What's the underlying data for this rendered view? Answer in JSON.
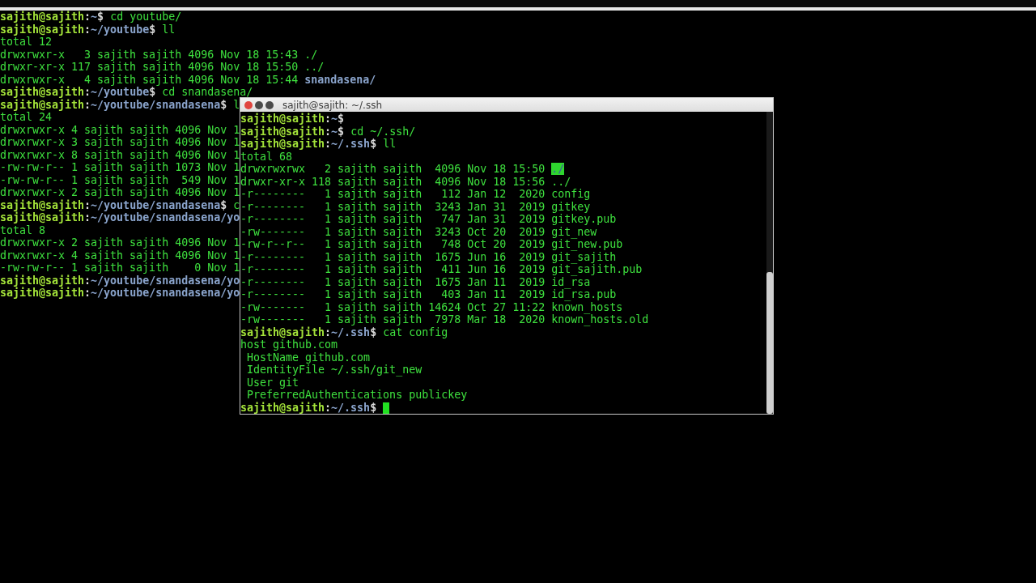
{
  "background_terminal": {
    "lines": [
      {
        "segments": [
          {
            "text": "sajith@sajith",
            "kind": "user"
          },
          {
            "text": ":",
            "kind": "sep"
          },
          {
            "text": "~",
            "kind": "path"
          },
          {
            "text": "$ ",
            "kind": "sep"
          },
          {
            "text": "cd youtube/",
            "kind": "cmd"
          }
        ]
      },
      {
        "segments": [
          {
            "text": "sajith@sajith",
            "kind": "user"
          },
          {
            "text": ":",
            "kind": "sep"
          },
          {
            "text": "~/youtube",
            "kind": "path"
          },
          {
            "text": "$ ",
            "kind": "sep"
          },
          {
            "text": "ll",
            "kind": "cmd"
          }
        ]
      },
      {
        "segments": [
          {
            "text": "total 12",
            "kind": "out"
          }
        ]
      },
      {
        "segments": [
          {
            "text": "drwxrwxr-x   3 sajith sajith 4096 Nov 18 15:43 ",
            "kind": "out"
          },
          {
            "text": "./",
            "kind": "out"
          }
        ]
      },
      {
        "segments": [
          {
            "text": "drwxr-xr-x 117 sajith sajith 4096 Nov 18 15:50 ",
            "kind": "out"
          },
          {
            "text": "../",
            "kind": "out"
          }
        ]
      },
      {
        "segments": [
          {
            "text": "drwxrwxr-x   4 sajith sajith 4096 Nov 18 15:44 ",
            "kind": "out"
          },
          {
            "text": "snandasena/",
            "kind": "dir"
          }
        ]
      },
      {
        "segments": [
          {
            "text": "sajith@sajith",
            "kind": "user"
          },
          {
            "text": ":",
            "kind": "sep"
          },
          {
            "text": "~/youtube",
            "kind": "path"
          },
          {
            "text": "$ ",
            "kind": "sep"
          },
          {
            "text": "cd snandasena/",
            "kind": "cmd"
          }
        ]
      },
      {
        "segments": [
          {
            "text": "sajith@sajith",
            "kind": "user"
          },
          {
            "text": ":",
            "kind": "sep"
          },
          {
            "text": "~/youtube/snandasena",
            "kind": "path"
          },
          {
            "text": "$ ",
            "kind": "sep"
          },
          {
            "text": "l",
            "kind": "cmd"
          }
        ]
      },
      {
        "segments": [
          {
            "text": "total 24",
            "kind": "out"
          }
        ]
      },
      {
        "segments": [
          {
            "text": "drwxrwxr-x 4 sajith sajith 4096 Nov 1",
            "kind": "out"
          }
        ]
      },
      {
        "segments": [
          {
            "text": "drwxrwxr-x 3 sajith sajith 4096 Nov 1",
            "kind": "out"
          }
        ]
      },
      {
        "segments": [
          {
            "text": "drwxrwxr-x 8 sajith sajith 4096 Nov 1",
            "kind": "out"
          }
        ]
      },
      {
        "segments": [
          {
            "text": "-rw-rw-r-- 1 sajith sajith 1073 Nov 1",
            "kind": "out"
          }
        ]
      },
      {
        "segments": [
          {
            "text": "-rw-rw-r-- 1 sajith sajith  549 Nov 1",
            "kind": "out"
          }
        ]
      },
      {
        "segments": [
          {
            "text": "drwxrwxr-x 2 sajith sajith 4096 Nov 1",
            "kind": "out"
          }
        ]
      },
      {
        "segments": [
          {
            "text": "sajith@sajith",
            "kind": "user"
          },
          {
            "text": ":",
            "kind": "sep"
          },
          {
            "text": "~/youtube/snandasena",
            "kind": "path"
          },
          {
            "text": "$ ",
            "kind": "sep"
          },
          {
            "text": "c",
            "kind": "cmd"
          }
        ]
      },
      {
        "segments": [
          {
            "text": "sajith@sajith",
            "kind": "user"
          },
          {
            "text": ":",
            "kind": "sep"
          },
          {
            "text": "~/youtube/snandasena/yo",
            "kind": "path"
          }
        ]
      },
      {
        "segments": [
          {
            "text": "total 8",
            "kind": "out"
          }
        ]
      },
      {
        "segments": [
          {
            "text": "drwxrwxr-x 2 sajith sajith 4096 Nov 1",
            "kind": "out"
          }
        ]
      },
      {
        "segments": [
          {
            "text": "drwxrwxr-x 4 sajith sajith 4096 Nov 1",
            "kind": "out"
          }
        ]
      },
      {
        "segments": [
          {
            "text": "-rw-rw-r-- 1 sajith sajith    0 Nov 1",
            "kind": "out"
          }
        ]
      },
      {
        "segments": [
          {
            "text": "sajith@sajith",
            "kind": "user"
          },
          {
            "text": ":",
            "kind": "sep"
          },
          {
            "text": "~/youtube/snandasena/yo",
            "kind": "path"
          }
        ]
      },
      {
        "segments": [
          {
            "text": "sajith@sajith",
            "kind": "user"
          },
          {
            "text": ":",
            "kind": "sep"
          },
          {
            "text": "~/youtube/snandasena/yo",
            "kind": "path"
          }
        ]
      }
    ]
  },
  "ssh_window": {
    "title": "sajith@sajith: ~/.ssh",
    "lines": [
      {
        "segments": [
          {
            "text": "sajith@sajith",
            "kind": "user"
          },
          {
            "text": ":",
            "kind": "sep"
          },
          {
            "text": "~",
            "kind": "path"
          },
          {
            "text": "$",
            "kind": "sep"
          }
        ]
      },
      {
        "segments": [
          {
            "text": "sajith@sajith",
            "kind": "user"
          },
          {
            "text": ":",
            "kind": "sep"
          },
          {
            "text": "~",
            "kind": "path"
          },
          {
            "text": "$ ",
            "kind": "sep"
          },
          {
            "text": "cd ~/.ssh/",
            "kind": "cmd"
          }
        ]
      },
      {
        "segments": [
          {
            "text": "sajith@sajith",
            "kind": "user"
          },
          {
            "text": ":",
            "kind": "sep"
          },
          {
            "text": "~/.ssh",
            "kind": "path"
          },
          {
            "text": "$ ",
            "kind": "sep"
          },
          {
            "text": "ll",
            "kind": "cmd"
          }
        ]
      },
      {
        "segments": [
          {
            "text": "total 68",
            "kind": "out"
          }
        ]
      },
      {
        "segments": [
          {
            "text": "drwxrwxrwx   2 sajith sajith  4096 Nov 18 15:50 ",
            "kind": "out"
          },
          {
            "text": "./",
            "kind": "owdir"
          }
        ]
      },
      {
        "segments": [
          {
            "text": "drwxr-xr-x 118 sajith sajith  4096 Nov 18 15:56 ",
            "kind": "out"
          },
          {
            "text": "../",
            "kind": "out"
          }
        ]
      },
      {
        "segments": [
          {
            "text": "-r--------   1 sajith sajith   112 Jan 12  2020 config",
            "kind": "out"
          }
        ]
      },
      {
        "segments": [
          {
            "text": "-r--------   1 sajith sajith  3243 Jan 31  2019 gitkey",
            "kind": "out"
          }
        ]
      },
      {
        "segments": [
          {
            "text": "-r--------   1 sajith sajith   747 Jan 31  2019 gitkey.pub",
            "kind": "out"
          }
        ]
      },
      {
        "segments": [
          {
            "text": "-rw-------   1 sajith sajith  3243 Oct 20  2019 git_new",
            "kind": "out"
          }
        ]
      },
      {
        "segments": [
          {
            "text": "-rw-r--r--   1 sajith sajith   748 Oct 20  2019 git_new.pub",
            "kind": "out"
          }
        ]
      },
      {
        "segments": [
          {
            "text": "-r--------   1 sajith sajith  1675 Jun 16  2019 git_sajith",
            "kind": "out"
          }
        ]
      },
      {
        "segments": [
          {
            "text": "-r--------   1 sajith sajith   411 Jun 16  2019 git_sajith.pub",
            "kind": "out"
          }
        ]
      },
      {
        "segments": [
          {
            "text": "-r--------   1 sajith sajith  1675 Jan 11  2019 id_rsa",
            "kind": "out"
          }
        ]
      },
      {
        "segments": [
          {
            "text": "-r--------   1 sajith sajith   403 Jan 11  2019 id_rsa.pub",
            "kind": "out"
          }
        ]
      },
      {
        "segments": [
          {
            "text": "-rw-------   1 sajith sajith 14624 Oct 27 11:22 known_hosts",
            "kind": "out"
          }
        ]
      },
      {
        "segments": [
          {
            "text": "-rw-------   1 sajith sajith  7978 Mar 18  2020 known_hosts.old",
            "kind": "out"
          }
        ]
      },
      {
        "segments": [
          {
            "text": "sajith@sajith",
            "kind": "user"
          },
          {
            "text": ":",
            "kind": "sep"
          },
          {
            "text": "~/.ssh",
            "kind": "path"
          },
          {
            "text": "$ ",
            "kind": "sep"
          },
          {
            "text": "cat config",
            "kind": "cmd"
          }
        ]
      },
      {
        "segments": [
          {
            "text": "host github.com",
            "kind": "out"
          }
        ]
      },
      {
        "segments": [
          {
            "text": " HostName github.com",
            "kind": "out"
          }
        ]
      },
      {
        "segments": [
          {
            "text": " IdentityFile ~/.ssh/git_new",
            "kind": "out"
          }
        ]
      },
      {
        "segments": [
          {
            "text": " User git",
            "kind": "out"
          }
        ]
      },
      {
        "segments": [
          {
            "text": " PreferredAuthentications publickey",
            "kind": "out"
          }
        ]
      },
      {
        "segments": [
          {
            "text": "sajith@sajith",
            "kind": "user"
          },
          {
            "text": ":",
            "kind": "sep"
          },
          {
            "text": "~/.ssh",
            "kind": "path"
          },
          {
            "text": "$ ",
            "kind": "sep"
          }
        ],
        "cursor": true
      }
    ]
  }
}
